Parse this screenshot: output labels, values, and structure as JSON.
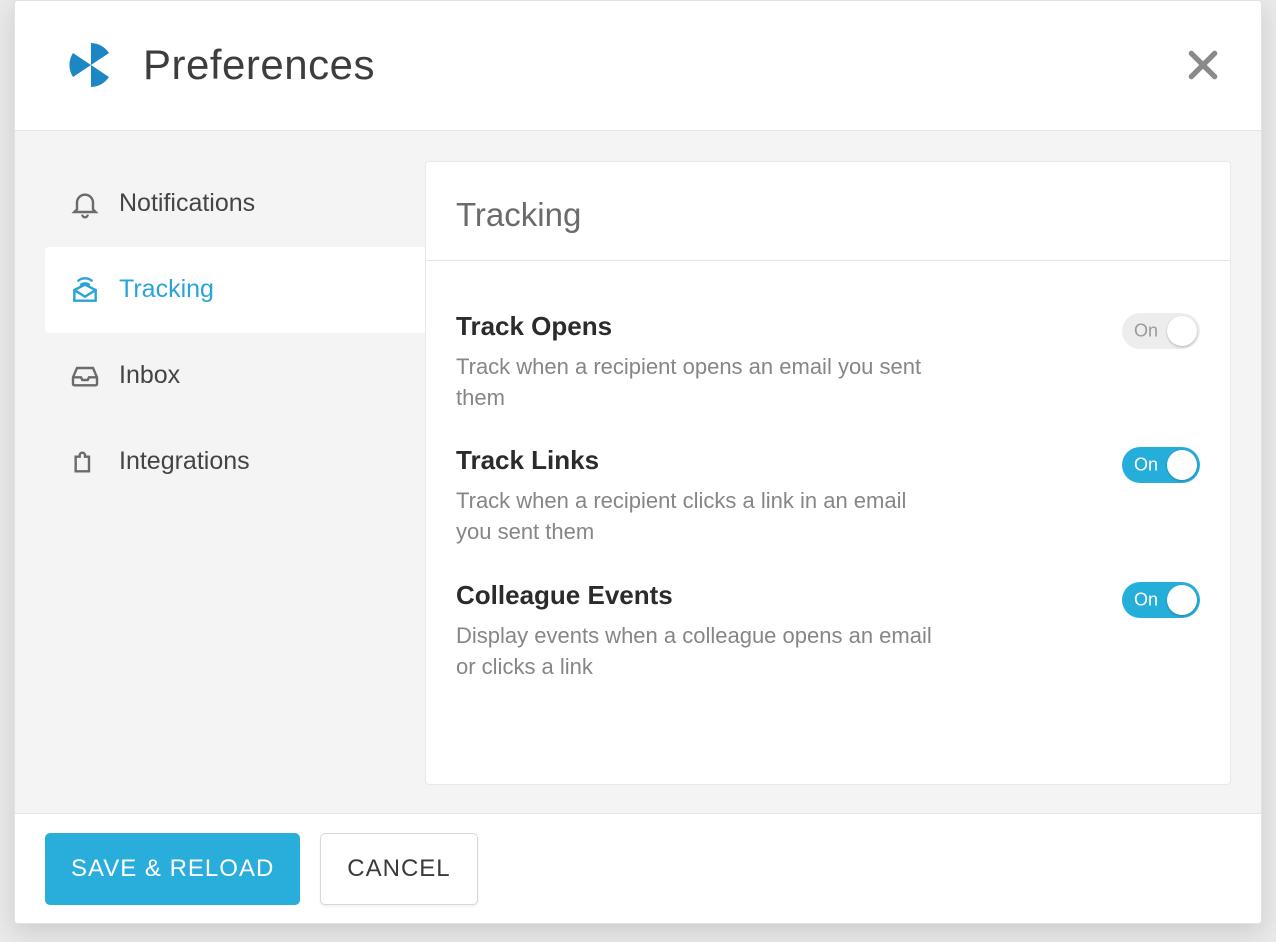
{
  "header": {
    "title": "Preferences"
  },
  "sidebar": {
    "items": [
      {
        "key": "notifications",
        "label": "Notifications",
        "active": false
      },
      {
        "key": "tracking",
        "label": "Tracking",
        "active": true
      },
      {
        "key": "inbox",
        "label": "Inbox",
        "active": false
      },
      {
        "key": "integrations",
        "label": "Integrations",
        "active": false
      }
    ]
  },
  "panel": {
    "title": "Tracking",
    "toggle_on_label": "On",
    "settings": [
      {
        "key": "track_opens",
        "title": "Track Opens",
        "description": "Track when a recipient opens an email you sent them",
        "enabled": false
      },
      {
        "key": "track_links",
        "title": "Track Links",
        "description": "Track when a recipient clicks a link in an email you sent them",
        "enabled": true
      },
      {
        "key": "colleague_events",
        "title": "Colleague Events",
        "description": "Display events when a colleague opens an email or clicks a link",
        "enabled": true
      }
    ]
  },
  "footer": {
    "save_label": "SAVE & RELOAD",
    "cancel_label": "CANCEL"
  }
}
